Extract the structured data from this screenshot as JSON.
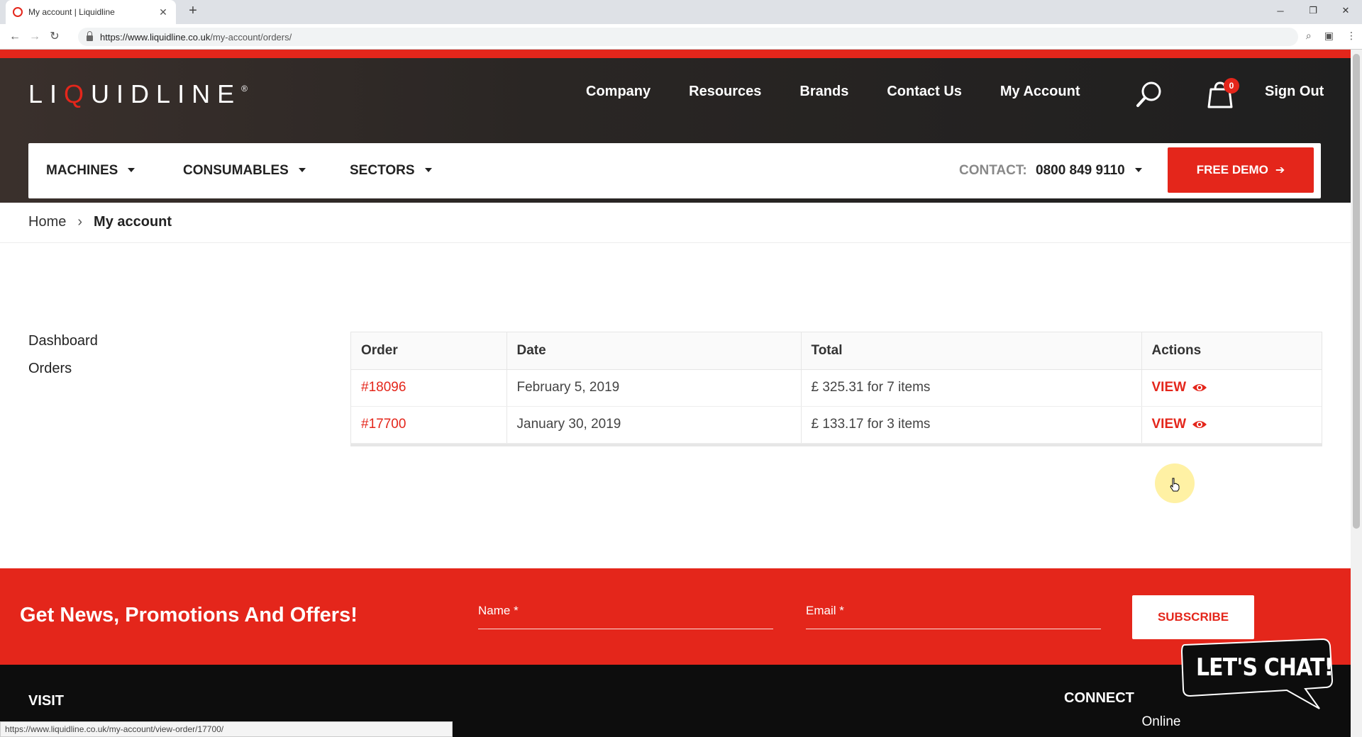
{
  "browser": {
    "tab_title": "My account | Liquidline",
    "url_host": "https://www.liquidline.co.uk",
    "url_path": "/my-account/orders/",
    "status_url": "https://www.liquidline.co.uk/my-account/view-order/17700/"
  },
  "header": {
    "logo_before": "LI",
    "logo_q": "Q",
    "logo_after": "UIDLINE",
    "logo_mark": "®",
    "nav": [
      "Company",
      "Resources",
      "Brands",
      "Contact Us",
      "My Account"
    ],
    "cart_count": "0",
    "sign_out": "Sign Out"
  },
  "menu": {
    "items": [
      "MACHINES",
      "CONSUMABLES",
      "SECTORS"
    ],
    "contact_label": "CONTACT:",
    "contact_number": "0800 849 9110",
    "free_demo": "FREE DEMO"
  },
  "breadcrumb": {
    "home": "Home",
    "separator": "›",
    "current": "My account"
  },
  "account_nav": [
    "Dashboard",
    "Orders"
  ],
  "orders": {
    "headers": [
      "Order",
      "Date",
      "Total",
      "Actions"
    ],
    "rows": [
      {
        "order": "#18096",
        "date": "February 5, 2019",
        "total": "£ 325.31 for 7 items",
        "action": "VIEW"
      },
      {
        "order": "#17700",
        "date": "January 30, 2019",
        "total": "£ 133.17 for 3 items",
        "action": "VIEW"
      }
    ]
  },
  "newsletter": {
    "title": "Get News, Promotions And Offers!",
    "name_placeholder": "Name *",
    "email_placeholder": "Email *",
    "subscribe": "SUBSCRIBE"
  },
  "footer": {
    "visit": "VISIT",
    "connect": "CONNECT"
  },
  "chat": {
    "label": "LET'S CHAT!",
    "status": "Online"
  },
  "colors": {
    "brand_red": "#e4261b",
    "header_dark": "#2a2624"
  }
}
